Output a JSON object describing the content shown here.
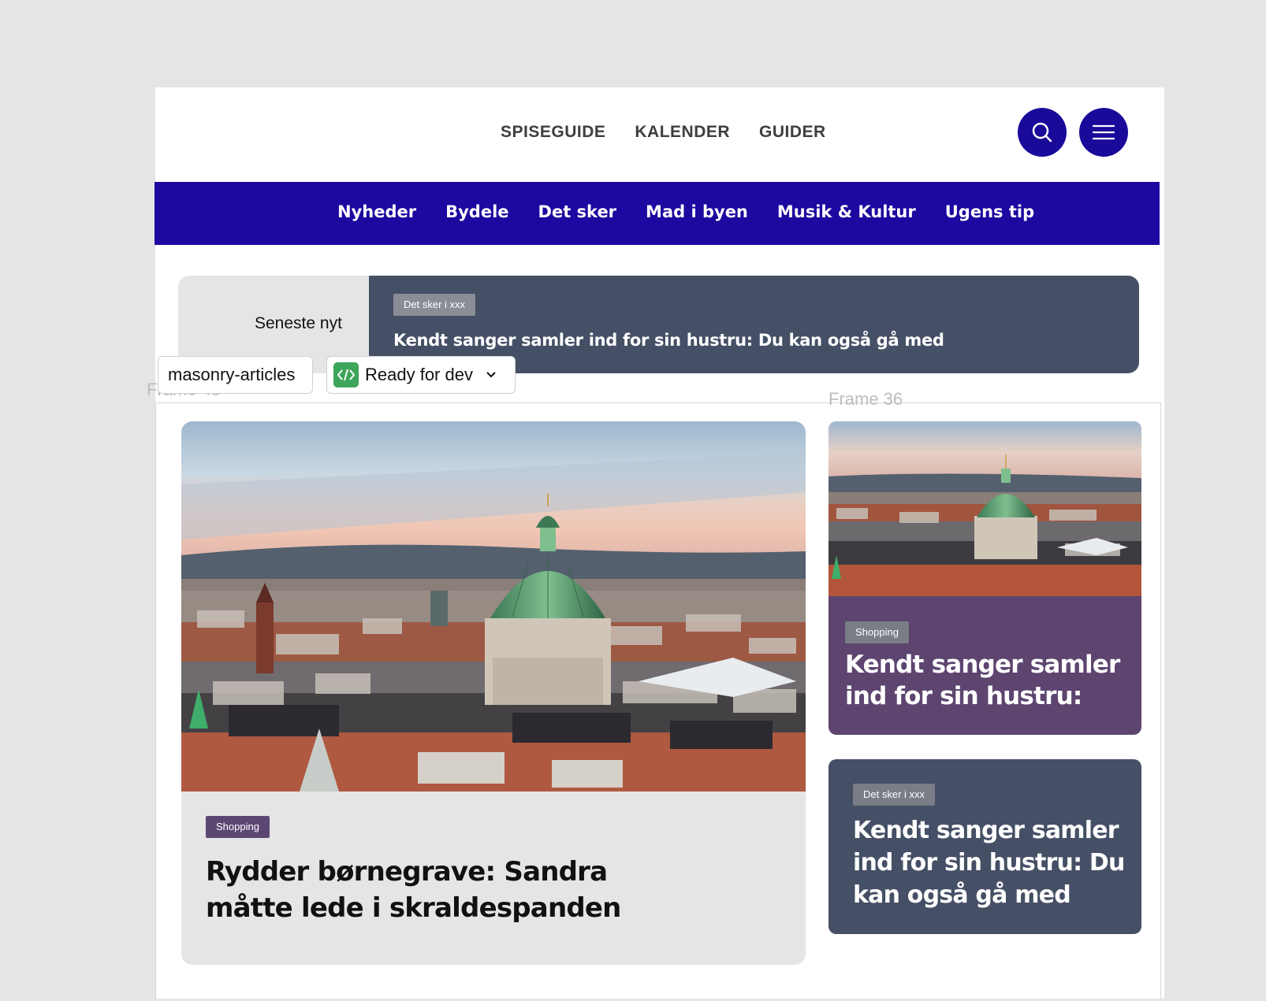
{
  "top_nav": {
    "links": [
      "SPISEGUIDE",
      "KALENDER",
      "GUIDER"
    ],
    "search_icon": "search-icon",
    "menu_icon": "hamburger-icon"
  },
  "main_nav": {
    "links": [
      "Nyheder",
      "Bydele",
      "Det sker",
      "Mad i byen",
      "Musik & Kultur",
      "Ugens tip"
    ]
  },
  "ticker": {
    "label": "Seneste nyt",
    "tag": "Det sker i xxx",
    "headline": "Kendt sanger samler ind for sin hustru: Du kan også gå med"
  },
  "figma": {
    "component_name": "masonry-articles",
    "status": "Ready for dev",
    "frame_left_label": "Frame 48",
    "frame_right_label": "Frame 36"
  },
  "articles": [
    {
      "tag": "Shopping",
      "title": "Rydder børnegrave: Sandra måtte lede i skraldespanden",
      "image": "copenhagen-skyline-frederiks-church"
    },
    {
      "tag": "Shopping",
      "title": "Kendt sanger samler ind for sin hustru:",
      "image": "copenhagen-skyline-frederiks-church"
    },
    {
      "tag": "Det sker i xxx",
      "title": "Kendt sanger samler ind for sin hustru: Du kan også gå med"
    }
  ],
  "colors": {
    "brand_blue": "#1d08a0",
    "button_blue": "#1a0a9a",
    "slate_card": "#454f65",
    "purple_card": "#5d4570",
    "light_grey": "#e5e5e5",
    "figma_green": "#3ea65a"
  }
}
